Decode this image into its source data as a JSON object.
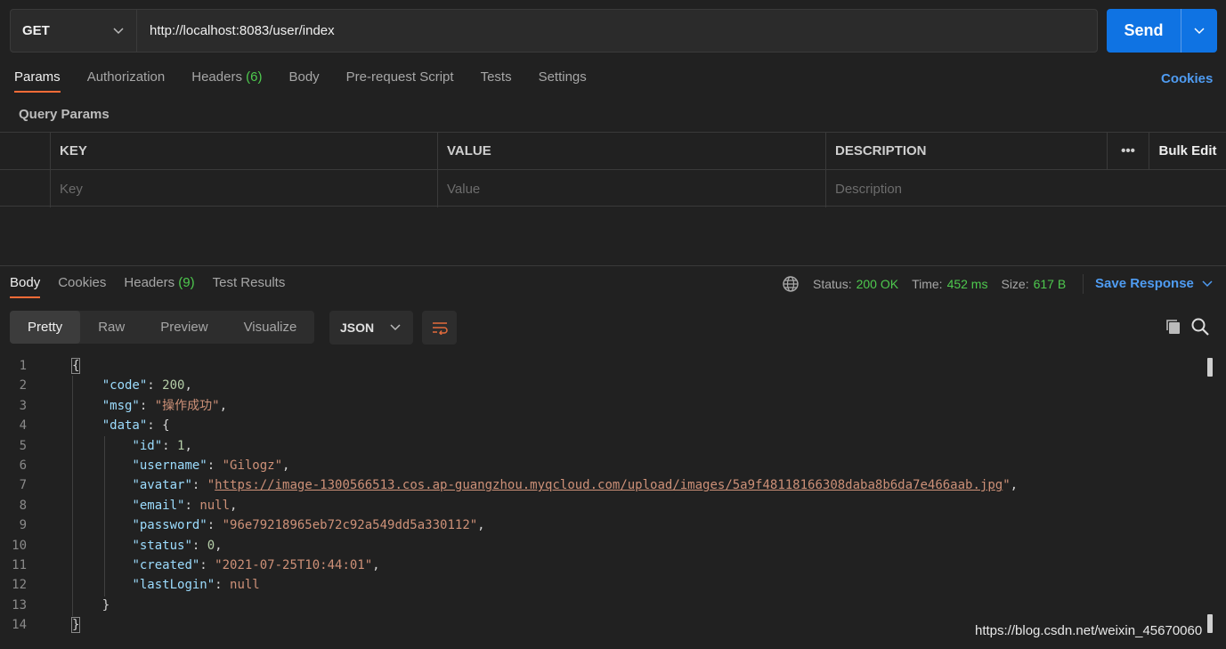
{
  "request": {
    "method": "GET",
    "url": "http://localhost:8083/user/index",
    "send_label": "Send"
  },
  "request_tabs": [
    {
      "label": "Params",
      "active": true
    },
    {
      "label": "Authorization"
    },
    {
      "label": "Headers",
      "count": "(6)"
    },
    {
      "label": "Body"
    },
    {
      "label": "Pre-request Script"
    },
    {
      "label": "Tests"
    },
    {
      "label": "Settings"
    }
  ],
  "cookies_label": "Cookies",
  "query_params": {
    "title": "Query Params",
    "headers": {
      "key": "KEY",
      "value": "VALUE",
      "description": "DESCRIPTION",
      "more": "•••",
      "bulk": "Bulk Edit"
    },
    "placeholders": {
      "key": "Key",
      "value": "Value",
      "description": "Description"
    }
  },
  "response": {
    "tabs": [
      {
        "label": "Body",
        "active": true
      },
      {
        "label": "Cookies"
      },
      {
        "label": "Headers",
        "count": "(9)"
      },
      {
        "label": "Test Results"
      }
    ],
    "status_label": "Status:",
    "status_value": "200 OK",
    "time_label": "Time:",
    "time_value": "452 ms",
    "size_label": "Size:",
    "size_value": "617 B",
    "save_label": "Save Response",
    "views": [
      "Pretty",
      "Raw",
      "Preview",
      "Visualize"
    ],
    "format": "JSON"
  },
  "code_lines": [
    {
      "n": "1",
      "open": "{"
    },
    {
      "n": "2",
      "key": "\"code\"",
      "num": "200",
      "tail": ","
    },
    {
      "n": "3",
      "key": "\"msg\"",
      "str": "\"操作成功\"",
      "tail": ","
    },
    {
      "n": "4",
      "key": "\"data\"",
      "obj": "{"
    },
    {
      "n": "5",
      "key": "\"id\"",
      "num": "1",
      "tail": ","
    },
    {
      "n": "6",
      "key": "\"username\"",
      "str": "\"Gilogz\"",
      "tail": ","
    },
    {
      "n": "7",
      "key": "\"avatar\"",
      "link": "https://image-1300566513.cos.ap-guangzhou.myqcloud.com/upload/images/5a9f48118166308daba8b6da7e466aab.jpg",
      "tail": ","
    },
    {
      "n": "8",
      "key": "\"email\"",
      "nul": "null",
      "tail": ","
    },
    {
      "n": "9",
      "key": "\"password\"",
      "str": "\"96e79218965eb72c92a549dd5a330112\"",
      "tail": ","
    },
    {
      "n": "10",
      "key": "\"status\"",
      "num": "0",
      "tail": ","
    },
    {
      "n": "11",
      "key": "\"created\"",
      "str": "\"2021-07-25T10:44:01\"",
      "tail": ","
    },
    {
      "n": "12",
      "key": "\"lastLogin\"",
      "nul": "null"
    },
    {
      "n": "13",
      "close": "}"
    },
    {
      "n": "14",
      "close_root": "}"
    }
  ],
  "watermark": "https://blog.csdn.net/weixin_45670060"
}
